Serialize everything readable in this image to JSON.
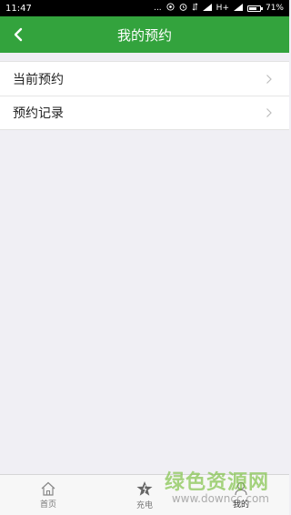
{
  "status_bar": {
    "time": "11:47",
    "dots": "...",
    "network": "H+",
    "battery": "71%",
    "battery_level": 0.71
  },
  "header": {
    "title": "我的预约",
    "background": "#33a33d"
  },
  "menu": {
    "items": [
      {
        "label": "当前预约"
      },
      {
        "label": "预约记录"
      }
    ]
  },
  "tabbar": {
    "tabs": [
      {
        "label": "首页",
        "icon": "home-icon"
      },
      {
        "label": "充电",
        "icon": "star-icon"
      },
      {
        "label": "我的",
        "icon": "person-icon"
      }
    ],
    "active": "我的"
  },
  "watermark": {
    "brand": "绿色资源网",
    "url": "www.downcc.com"
  }
}
